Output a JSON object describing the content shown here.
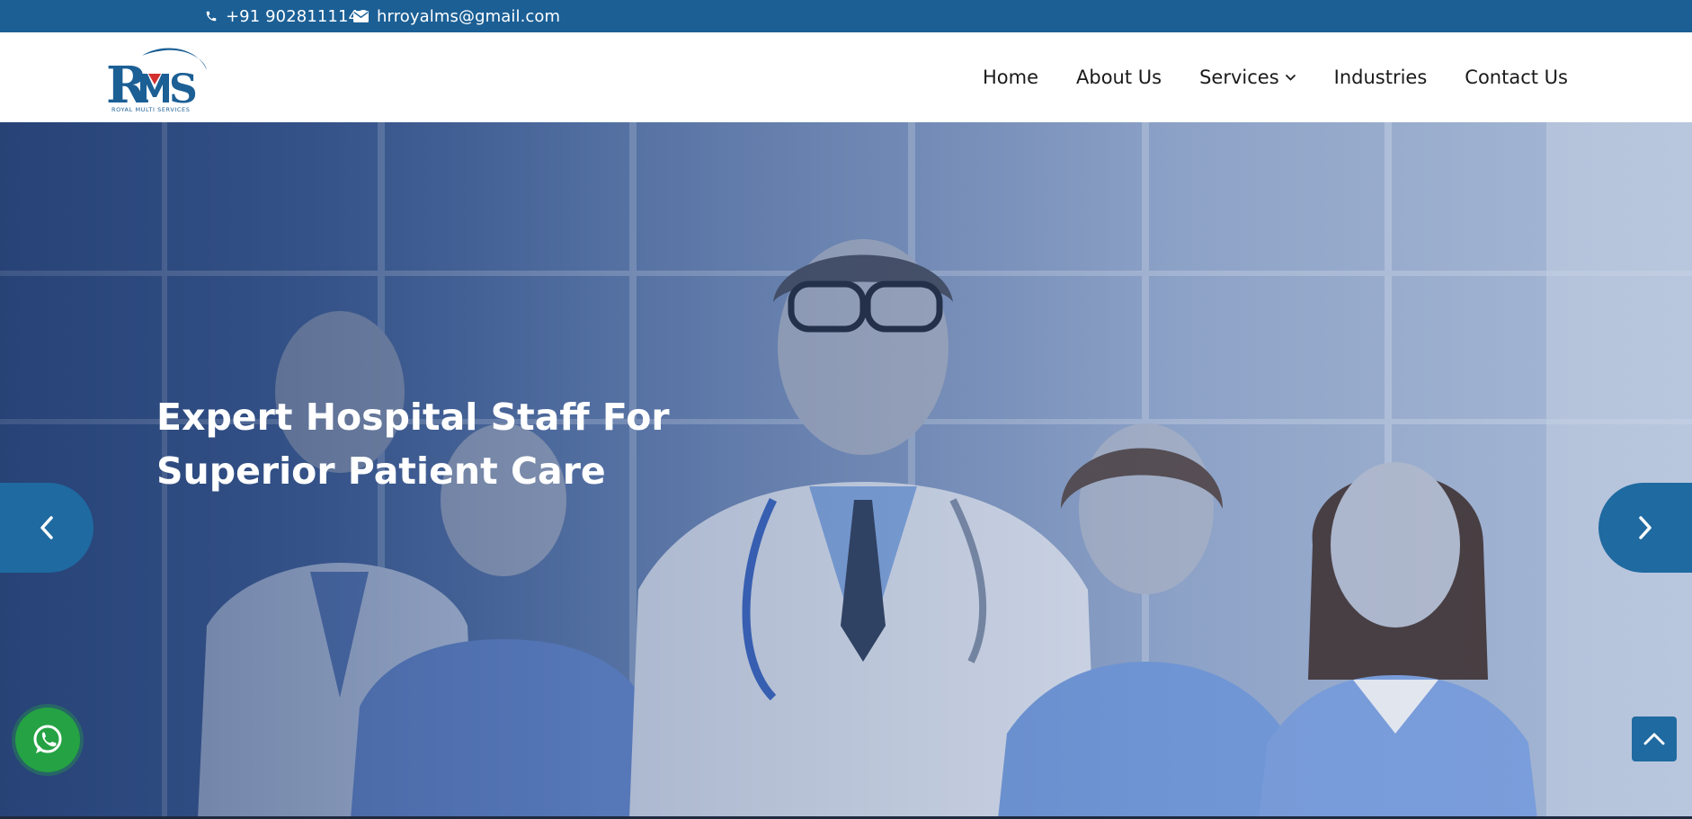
{
  "topbar": {
    "phone": "+91 9028111142",
    "email": "hrroyalms@gmail.com",
    "phone_icon": "phone-icon",
    "email_icon": "envelope-icon"
  },
  "brand": {
    "logo_text": "RMS",
    "tagline": "ROYAL MULTI SERVICES",
    "primary_color": "#1b5f95",
    "accent_color": "#d32f2f"
  },
  "nav": {
    "items": [
      {
        "label": "Home"
      },
      {
        "label": "About Us"
      },
      {
        "label": "Services",
        "has_dropdown": true
      },
      {
        "label": "Industries"
      },
      {
        "label": "Contact Us"
      }
    ]
  },
  "hero": {
    "title": "Expert Hospital Staff For Superior Patient Care",
    "prev_icon": "chevron-left-icon",
    "next_icon": "chevron-right-icon"
  },
  "floating": {
    "whatsapp_icon": "whatsapp-icon",
    "back_to_top_icon": "chevron-up-icon",
    "whatsapp_color": "#25a244"
  }
}
